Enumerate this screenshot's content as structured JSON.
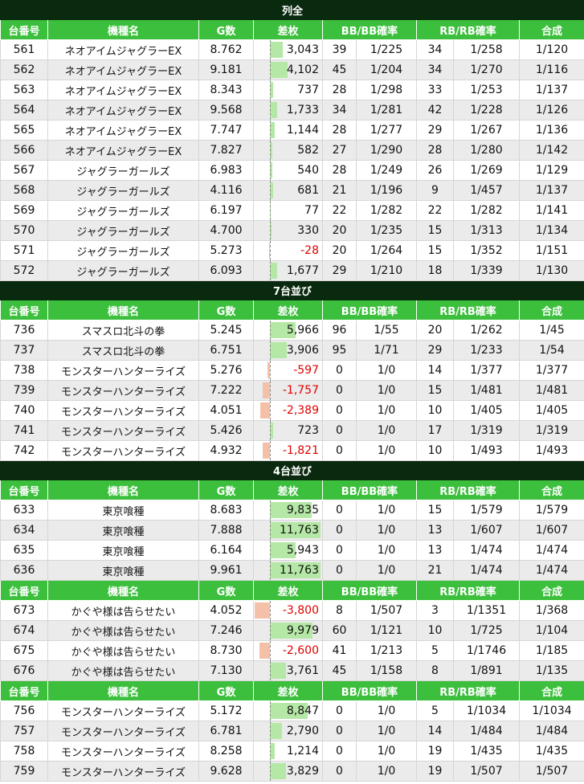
{
  "headers": [
    "台番号",
    "機種名",
    "G数",
    "差枚",
    "BB/BB確率",
    "RB/RB確率",
    "合成"
  ],
  "sections": [
    {
      "title": "列全",
      "groups": [
        {
          "rows": [
            [
              "561",
              "ネオアイムジャグラーEX",
              "8.762",
              3043,
              "39",
              "1/225",
              "34",
              "1/258",
              "1/120"
            ],
            [
              "562",
              "ネオアイムジャグラーEX",
              "9.181",
              4102,
              "45",
              "1/204",
              "34",
              "1/270",
              "1/116"
            ],
            [
              "563",
              "ネオアイムジャグラーEX",
              "8.343",
              737,
              "28",
              "1/298",
              "33",
              "1/253",
              "1/137"
            ],
            [
              "564",
              "ネオアイムジャグラーEX",
              "9.568",
              1733,
              "34",
              "1/281",
              "42",
              "1/228",
              "1/126"
            ],
            [
              "565",
              "ネオアイムジャグラーEX",
              "7.747",
              1144,
              "28",
              "1/277",
              "29",
              "1/267",
              "1/136"
            ],
            [
              "566",
              "ネオアイムジャグラーEX",
              "7.827",
              582,
              "27",
              "1/290",
              "28",
              "1/280",
              "1/142"
            ],
            [
              "567",
              "ジャグラーガールズ",
              "6.983",
              540,
              "28",
              "1/249",
              "26",
              "1/269",
              "1/129"
            ],
            [
              "568",
              "ジャグラーガールズ",
              "4.116",
              681,
              "21",
              "1/196",
              "9",
              "1/457",
              "1/137"
            ],
            [
              "569",
              "ジャグラーガールズ",
              "6.197",
              77,
              "22",
              "1/282",
              "22",
              "1/282",
              "1/141"
            ],
            [
              "570",
              "ジャグラーガールズ",
              "4.700",
              330,
              "20",
              "1/235",
              "15",
              "1/313",
              "1/134"
            ],
            [
              "571",
              "ジャグラーガールズ",
              "5.273",
              -28,
              "20",
              "1/264",
              "15",
              "1/352",
              "1/151"
            ],
            [
              "572",
              "ジャグラーガールズ",
              "6.093",
              1677,
              "29",
              "1/210",
              "18",
              "1/339",
              "1/130"
            ]
          ]
        }
      ]
    },
    {
      "title": "7台並び",
      "groups": [
        {
          "rows": [
            [
              "736",
              "スマスロ北斗の拳",
              "5.245",
              5966,
              "96",
              "1/55",
              "20",
              "1/262",
              "1/45"
            ],
            [
              "737",
              "スマスロ北斗の拳",
              "6.751",
              3906,
              "95",
              "1/71",
              "29",
              "1/233",
              "1/54"
            ],
            [
              "738",
              "モンスターハンターライズ",
              "5.276",
              -597,
              "0",
              "1/0",
              "14",
              "1/377",
              "1/377"
            ],
            [
              "739",
              "モンスターハンターライズ",
              "7.222",
              -1757,
              "0",
              "1/0",
              "15",
              "1/481",
              "1/481"
            ],
            [
              "740",
              "モンスターハンターライズ",
              "4.051",
              -2389,
              "0",
              "1/0",
              "10",
              "1/405",
              "1/405"
            ],
            [
              "741",
              "モンスターハンターライズ",
              "5.426",
              723,
              "0",
              "1/0",
              "17",
              "1/319",
              "1/319"
            ],
            [
              "742",
              "モンスターハンターライズ",
              "4.932",
              -1821,
              "0",
              "1/0",
              "10",
              "1/493",
              "1/493"
            ]
          ]
        }
      ]
    },
    {
      "title": "4台並び",
      "groups": [
        {
          "rows": [
            [
              "633",
              "東京喰種",
              "8.683",
              9835,
              "0",
              "1/0",
              "15",
              "1/579",
              "1/579"
            ],
            [
              "634",
              "東京喰種",
              "7.888",
              11763,
              "0",
              "1/0",
              "13",
              "1/607",
              "1/607"
            ],
            [
              "635",
              "東京喰種",
              "6.164",
              5943,
              "0",
              "1/0",
              "13",
              "1/474",
              "1/474"
            ],
            [
              "636",
              "東京喰種",
              "9.961",
              11763,
              "0",
              "1/0",
              "21",
              "1/474",
              "1/474"
            ]
          ]
        },
        {
          "rows": [
            [
              "673",
              "かぐや様は告らせたい",
              "4.052",
              -3800,
              "8",
              "1/507",
              "3",
              "1/1351",
              "1/368"
            ],
            [
              "674",
              "かぐや様は告らせたい",
              "7.246",
              9979,
              "60",
              "1/121",
              "10",
              "1/725",
              "1/104"
            ],
            [
              "675",
              "かぐや様は告らせたい",
              "8.730",
              -2600,
              "41",
              "1/213",
              "5",
              "1/1746",
              "1/185"
            ],
            [
              "676",
              "かぐや様は告らせたい",
              "7.130",
              3761,
              "45",
              "1/158",
              "8",
              "1/891",
              "1/135"
            ]
          ]
        },
        {
          "rows": [
            [
              "756",
              "モンスターハンターライズ",
              "5.172",
              8847,
              "0",
              "1/0",
              "5",
              "1/1034",
              "1/1034"
            ],
            [
              "757",
              "モンスターハンターライズ",
              "6.781",
              2790,
              "0",
              "1/0",
              "14",
              "1/484",
              "1/484"
            ],
            [
              "758",
              "モンスターハンターライズ",
              "8.258",
              1214,
              "0",
              "1/0",
              "19",
              "1/435",
              "1/435"
            ],
            [
              "759",
              "モンスターハンターライズ",
              "9.628",
              3829,
              "0",
              "1/0",
              "19",
              "1/507",
              "1/507"
            ]
          ]
        }
      ]
    }
  ],
  "colors": {
    "section_bg": "#0a2a0f",
    "header_bg": "#3cbf3c",
    "positive_bar": "#b5e8a6",
    "negative_bar": "#f5c0a8",
    "negative_text": "#e00000",
    "alt_row": "#ebebeb"
  }
}
